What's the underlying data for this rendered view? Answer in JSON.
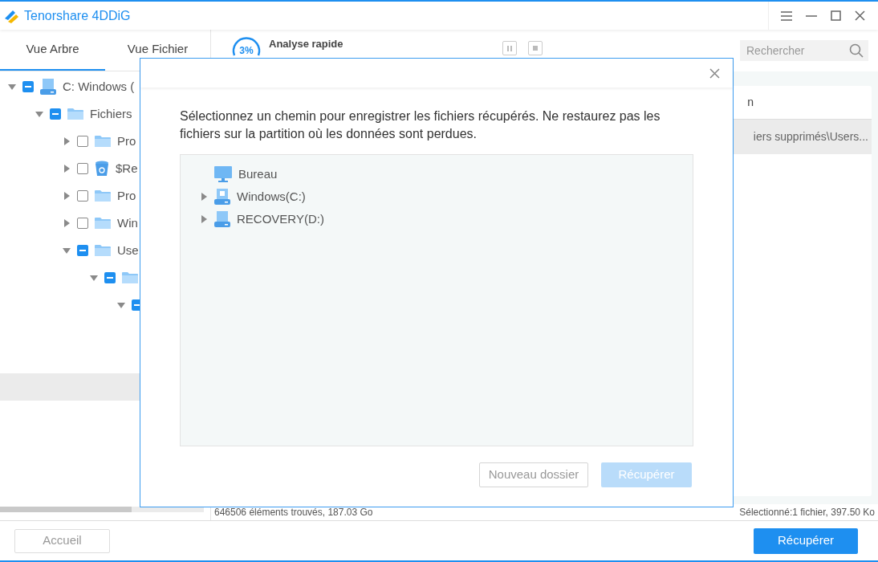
{
  "app": {
    "title": "Tenorshare 4DDiG"
  },
  "window_controls": [
    {
      "kind": "menu"
    },
    {
      "kind": "minimize"
    },
    {
      "kind": "maximize"
    },
    {
      "kind": "close"
    }
  ],
  "view_tabs": [
    {
      "label": "Vue Arbre",
      "selected": true
    },
    {
      "label": "Vue Fichier",
      "selected": false
    }
  ],
  "tree": [
    {
      "label": "C: Windows (",
      "kind": "drive",
      "checked": true,
      "expanded": true,
      "children": [
        {
          "label": "Fichiers",
          "kind": "folder",
          "checked": true,
          "expanded": true,
          "children": [
            {
              "label": "Pro",
              "kind": "folder",
              "checked": false,
              "expanded": false
            },
            {
              "label": "$Re",
              "kind": "recycle",
              "checked": false,
              "expanded": false
            },
            {
              "label": "Pro",
              "kind": "folder",
              "checked": false,
              "expanded": false
            },
            {
              "label": "Win",
              "kind": "folder",
              "checked": false,
              "expanded": false
            },
            {
              "label": "Use",
              "kind": "folder",
              "checked": true,
              "expanded": true,
              "children": [
                {
                  "kind": "folder",
                  "checked": true,
                  "expanded": true,
                  "children": [
                    {
                      "checked": true,
                      "expanded": true
                    }
                  ]
                }
              ]
            }
          ]
        }
      ]
    }
  ],
  "tree_selection": {
    "selected": true
  },
  "scan": {
    "progress": "3%",
    "title": "Analyse rapide"
  },
  "search": {
    "placeholder": "Rechercher"
  },
  "table": {
    "column_2": "n",
    "rows": [
      {
        "column_2": "iers supprimés\\Users...",
        "selected": true
      }
    ]
  },
  "status": {
    "found": "646506 éléments trouvés, 187.03 Go",
    "selected_info": "Sélectionné:1 fichier, 397.50 Ko"
  },
  "footer": {
    "home": "Accueil",
    "recover": "Récupérer"
  },
  "dialog": {
    "message": "Sélectionnez un chemin pour enregistrer les fichiers récupérés. Ne restaurez pas les fichiers sur la partition où les données sont perdues.",
    "locations": [
      {
        "label": "Bureau",
        "kind": "desktop",
        "expandable": false
      },
      {
        "label": "Windows(C:)",
        "kind": "windows-drive",
        "expandable": true
      },
      {
        "label": "RECOVERY(D:)",
        "kind": "drive",
        "expandable": true
      }
    ],
    "new_folder": "Nouveau dossier",
    "recover": {
      "label": "Récupérer",
      "disabled": true
    }
  }
}
